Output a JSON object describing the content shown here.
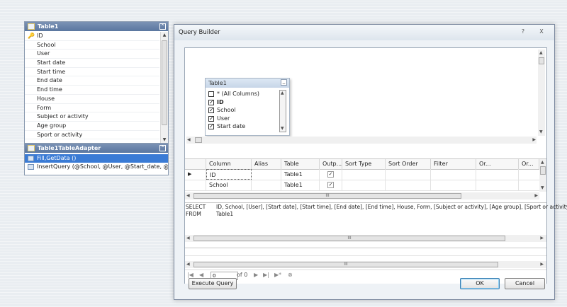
{
  "table_panel": {
    "title": "Table1",
    "columns": [
      "ID",
      "School",
      "User",
      "Start date",
      "Start time",
      "End date",
      "End time",
      "House",
      "Form",
      "Subject or activity",
      "Age group",
      "Sport or activity"
    ]
  },
  "adapter_panel": {
    "title": "Table1TableAdapter",
    "methods": [
      "Fill,GetData ()",
      "InsertQuery (@School, @User, @Start_date, @Sta..."
    ]
  },
  "dialog": {
    "title": "Query Builder",
    "help_label": "?",
    "close_label": "X",
    "diagram": {
      "table_title": "Table1",
      "items": [
        {
          "label": "* (All Columns)",
          "checked": false
        },
        {
          "label": "ID",
          "checked": true
        },
        {
          "label": "School",
          "checked": true
        },
        {
          "label": "User",
          "checked": true
        },
        {
          "label": "Start date",
          "checked": true
        }
      ]
    },
    "grid": {
      "headers": [
        "Column",
        "Alias",
        "Table",
        "Outp...",
        "Sort Type",
        "Sort Order",
        "Filter",
        "Or...",
        "Or..."
      ],
      "rows": [
        {
          "column": "ID",
          "alias": "",
          "table": "Table1",
          "output": true
        },
        {
          "column": "School",
          "alias": "",
          "table": "Table1",
          "output": true
        }
      ],
      "scroll_mark": "III"
    },
    "sql": {
      "select_kw": "SELECT",
      "select_text": "ID, School, [User], [Start date], [Start time], [End date], [End time], House, Form, [Subject or activity], [Age group], [Sport or activity]",
      "from_kw": "FROM",
      "from_text": "Table1"
    },
    "results": {
      "page_value": "0",
      "of_label": "of 0"
    },
    "buttons": {
      "execute": "Execute Query",
      "ok": "OK",
      "cancel": "Cancel"
    }
  }
}
